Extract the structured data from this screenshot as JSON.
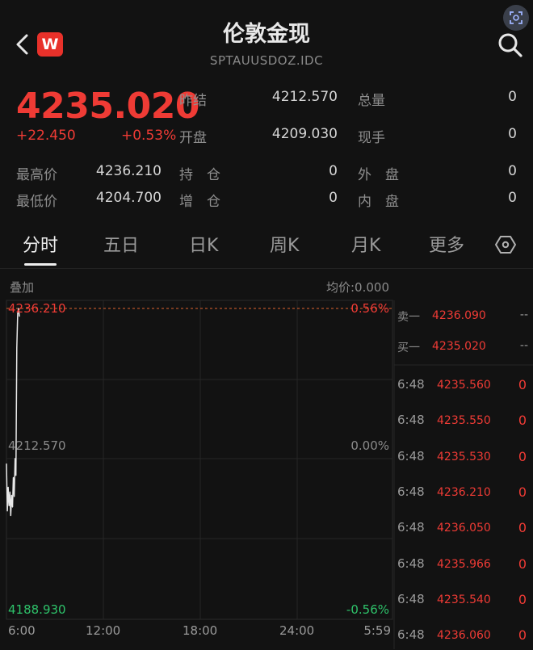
{
  "header": {
    "title": "伦敦金现",
    "subtitle": "SPTAUUSDOZ.IDC",
    "logo_letter": "W",
    "logo_color": "#e8312a",
    "icons": [
      "chevron-left-icon",
      "search-icon",
      "screenshot-icon"
    ]
  },
  "quote": {
    "price": "4235.020",
    "change": "+22.450",
    "change_pct": "+0.53%",
    "prev_close_label": "昨结",
    "prev_close": "4212.570",
    "open_label": "开盘",
    "open": "4209.030",
    "total_volume_label": "总量",
    "total_volume": "0",
    "current_hand_label": "现手",
    "current_hand": "0",
    "high_label": "最高价",
    "high": "4236.210",
    "low_label": "最低价",
    "low": "4204.700",
    "holding_label": "持　仓",
    "holding": "0",
    "add_pos_label": "增　仓",
    "add_pos": "0",
    "outer_label": "外　盘",
    "outer": "0",
    "inner_label": "内　盘",
    "inner": "0",
    "up_color": "#ef3b35",
    "down_color": "#2ec26a"
  },
  "tabs": {
    "items": [
      "分时",
      "五日",
      "日K",
      "周K",
      "月K",
      "更多"
    ],
    "active": "分时",
    "settings_icon": "hexagon-settings-icon"
  },
  "chart": {
    "overlay_label": "叠加",
    "avg_price_label": "均价:0.000",
    "top_price": "4236.210",
    "top_pct": "0.56%",
    "mid_price": "4212.570",
    "mid_pct": "0.00%",
    "bottom_price": "4188.930",
    "bottom_pct": "-0.56%",
    "time_labels": [
      "6:00",
      "12:00",
      "18:00",
      "24:00",
      "5:59"
    ]
  },
  "chart_data": {
    "type": "line",
    "title": "",
    "xlabel": "",
    "ylabel": "",
    "ylim": [
      4188.93,
      4236.21
    ],
    "x_ticks": [
      "6:00",
      "12:00",
      "18:00",
      "24:00",
      "5:59"
    ],
    "series": [
      {
        "values": [
          4212.57,
          4205.4,
          4209.03,
          4206.2,
          4208.3,
          4204.7,
          4207.8,
          4206.0,
          4210.5,
          4207.6,
          4213.4,
          4210.8,
          4230.2,
          4235.4,
          4236.21,
          4235.02
        ]
      }
    ]
  },
  "order_book": {
    "sell1_label": "卖一",
    "sell1_price": "4236.090",
    "sell1_vol": "--",
    "buy1_label": "买一",
    "buy1_price": "4235.020",
    "buy1_vol": "--"
  },
  "ticks": [
    {
      "time": "6:48",
      "price": "4235.560",
      "vol": "0"
    },
    {
      "time": "6:48",
      "price": "4235.550",
      "vol": "0"
    },
    {
      "time": "6:48",
      "price": "4235.530",
      "vol": "0"
    },
    {
      "time": "6:48",
      "price": "4236.210",
      "vol": "0"
    },
    {
      "time": "6:48",
      "price": "4236.050",
      "vol": "0"
    },
    {
      "time": "6:48",
      "price": "4235.966",
      "vol": "0"
    },
    {
      "time": "6:48",
      "price": "4235.540",
      "vol": "0"
    },
    {
      "time": "6:48",
      "price": "4236.060",
      "vol": "0"
    }
  ]
}
